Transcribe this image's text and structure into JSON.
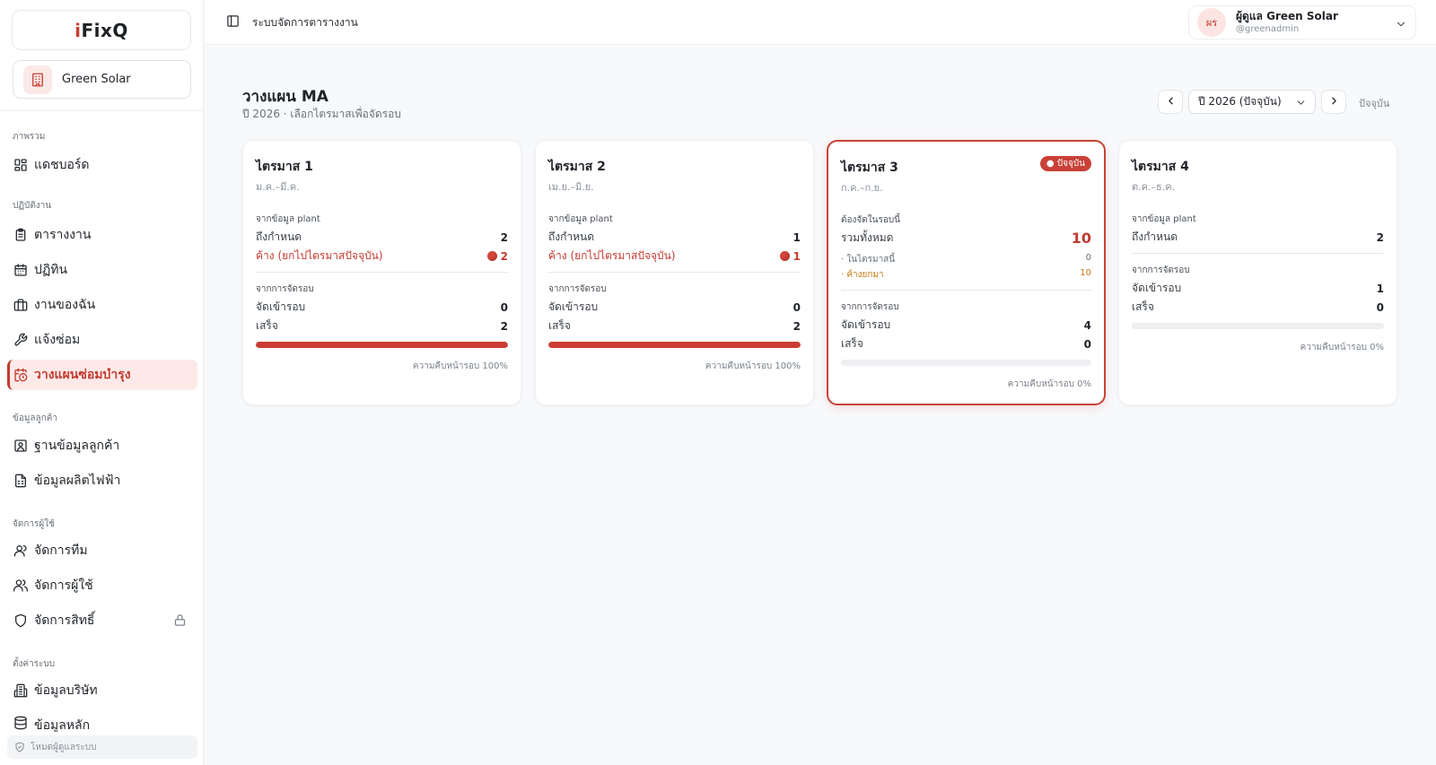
{
  "brand": {
    "logo_i": "i",
    "logo_rest": "FixQ",
    "org_name": "Green Solar",
    "logo_color": "#cc3d32"
  },
  "sidebar": {
    "sections": [
      {
        "label": "ภาพรวม"
      },
      {
        "label": "ปฏิบัติงาน"
      },
      {
        "label": "ข้อมูลลูกค้า"
      },
      {
        "label": "จัดการผู้ใช้"
      },
      {
        "label": "ตั้งค่าระบบ"
      }
    ],
    "items": [
      {
        "label": "แดชบอร์ด",
        "icon": "dashboard-icon"
      },
      {
        "label": "ตารางงาน",
        "icon": "clipboard-icon"
      },
      {
        "label": "ปฏิทิน",
        "icon": "calendar-icon"
      },
      {
        "label": "งานของฉัน",
        "icon": "briefcase-icon"
      },
      {
        "label": "แจ้งซ่อม",
        "icon": "wrench-icon"
      },
      {
        "label": "วางแผนซ่อมบำรุง",
        "icon": "calendar-clock-icon",
        "active": true
      },
      {
        "label": "ฐานข้อมูลลูกค้า",
        "icon": "contact-icon"
      },
      {
        "label": "ข้อมูลผลิตไฟฟ้า",
        "icon": "file-chart-icon"
      },
      {
        "label": "จัดการทีม",
        "icon": "user-icon"
      },
      {
        "label": "จัดการผู้ใช้",
        "icon": "users-icon"
      },
      {
        "label": "จัดการสิทธิ์",
        "icon": "shield-icon",
        "locked": true
      },
      {
        "label": "ข้อมูลบริษัท",
        "icon": "building-icon"
      },
      {
        "label": "ข้อมูลหลัก",
        "icon": "database-icon"
      }
    ],
    "footer": "โหมดผู้ดูแลระบบ"
  },
  "header": {
    "title": "ระบบจัดการตารางงาน",
    "user": {
      "initials": "ผร",
      "name": "ผู้ดูแล Green Solar",
      "handle": "@greenadmin"
    }
  },
  "page": {
    "title": "วางแผน MA",
    "subtitle": "ปี 2026 · เลือกไตรมาสเพื่อจัดรอบ",
    "year_select": "ปี 2026 (ปัจจุบัน)",
    "today_label": "ปัจจุบัน"
  },
  "quarters": [
    {
      "title": "ไตรมาส 1",
      "months": "ม.ค.–มี.ค.",
      "plant_label": "จากข้อมูล plant",
      "due_label": "ถึงกำหนด",
      "due_value": "2",
      "overdue_label": "ค้าง (ยกไปไตรมาสปัจจุบัน)",
      "overdue_value": "2",
      "schedule_label": "จากการจัดรอบ",
      "assigned_label": "จัดเข้ารอบ",
      "assigned_value": "0",
      "done_label": "เสร็จ",
      "done_value": "2",
      "progress": 100,
      "progress_text": "ความคืบหน้ารอบ 100%"
    },
    {
      "title": "ไตรมาส 2",
      "months": "เม.ย.–มิ.ย.",
      "plant_label": "จากข้อมูล plant",
      "due_label": "ถึงกำหนด",
      "due_value": "1",
      "overdue_label": "ค้าง (ยกไปไตรมาสปัจจุบัน)",
      "overdue_value": "1",
      "schedule_label": "จากการจัดรอบ",
      "assigned_label": "จัดเข้ารอบ",
      "assigned_value": "0",
      "done_label": "เสร็จ",
      "done_value": "2",
      "progress": 100,
      "progress_text": "ความคืบหน้ารอบ 100%"
    },
    {
      "title": "ไตรมาส 3",
      "months": "ก.ค.–ก.ย.",
      "badge": "● ปัจจุบัน",
      "need_label": "ต้องจัดในรอบนี้",
      "total_label": "รวมทั้งหมด",
      "total_value": "10",
      "in_quarter_label": "· ในไตรมาสนี้",
      "in_quarter_value": "0",
      "carried_label": "· ค้างยกมา",
      "carried_value": "10",
      "schedule_label": "จากการจัดรอบ",
      "assigned_label": "จัดเข้ารอบ",
      "assigned_value": "4",
      "done_label": "เสร็จ",
      "done_value": "0",
      "progress": 0,
      "progress_text": "ความคืบหน้ารอบ 0%"
    },
    {
      "title": "ไตรมาส 4",
      "months": "ต.ค.–ธ.ค.",
      "plant_label": "จากข้อมูล plant",
      "due_label": "ถึงกำหนด",
      "due_value": "2",
      "schedule_label": "จากการจัดรอบ",
      "assigned_label": "จัดเข้ารอบ",
      "assigned_value": "1",
      "done_label": "เสร็จ",
      "done_value": "0",
      "progress": 0,
      "progress_text": "ความคืบหน้ารอบ 0%"
    }
  ],
  "colors": {
    "accent": "#cc3d32",
    "accent_bg": "#fdeae8",
    "warning": "#c97a12"
  }
}
